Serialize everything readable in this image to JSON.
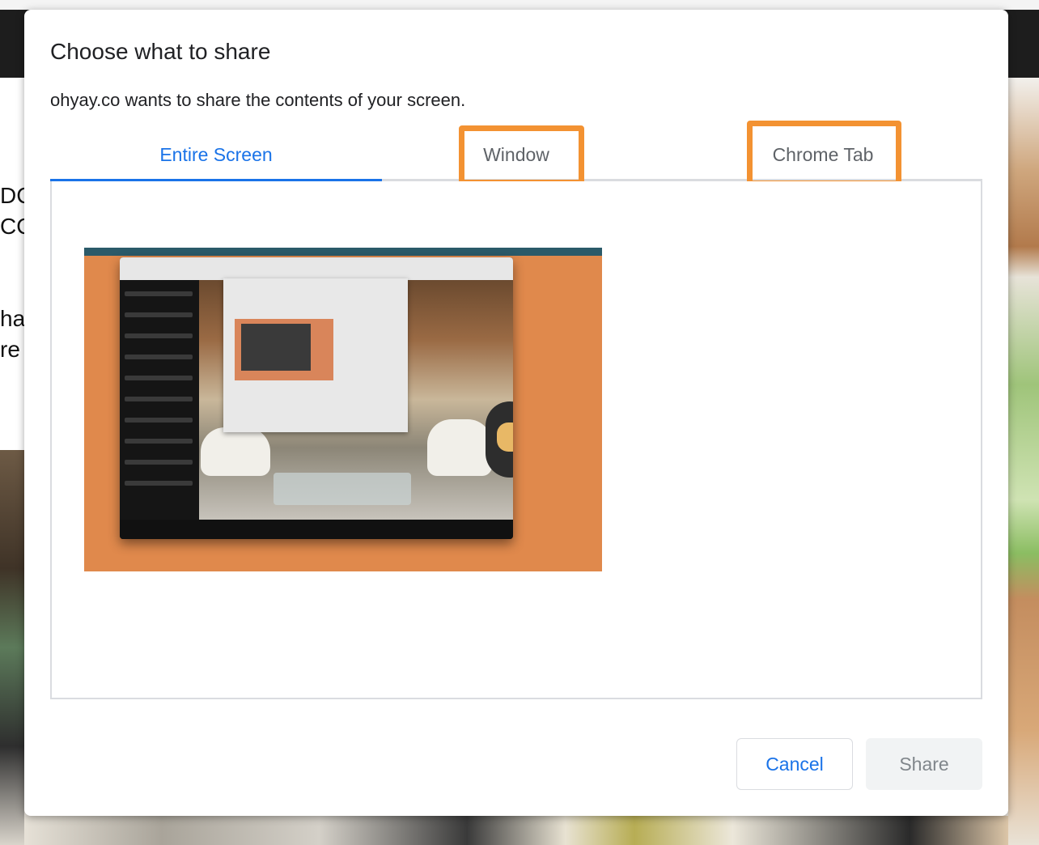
{
  "background": {
    "left_text_lines": [
      "DC",
      "CO",
      "ha",
      "re"
    ]
  },
  "dialog": {
    "title": "Choose what to share",
    "subtitle": "ohyay.co wants to share the contents of your screen.",
    "tabs": [
      {
        "label": "Entire Screen",
        "selected": true,
        "highlighted": false
      },
      {
        "label": "Window",
        "selected": false,
        "highlighted": true
      },
      {
        "label": "Chrome Tab",
        "selected": false,
        "highlighted": true
      }
    ],
    "buttons": {
      "cancel_label": "Cancel",
      "share_label": "Share"
    }
  },
  "colors": {
    "accent": "#1a73e8",
    "highlight_box": "#f39232",
    "thumbnail_background": "#e0894c"
  }
}
